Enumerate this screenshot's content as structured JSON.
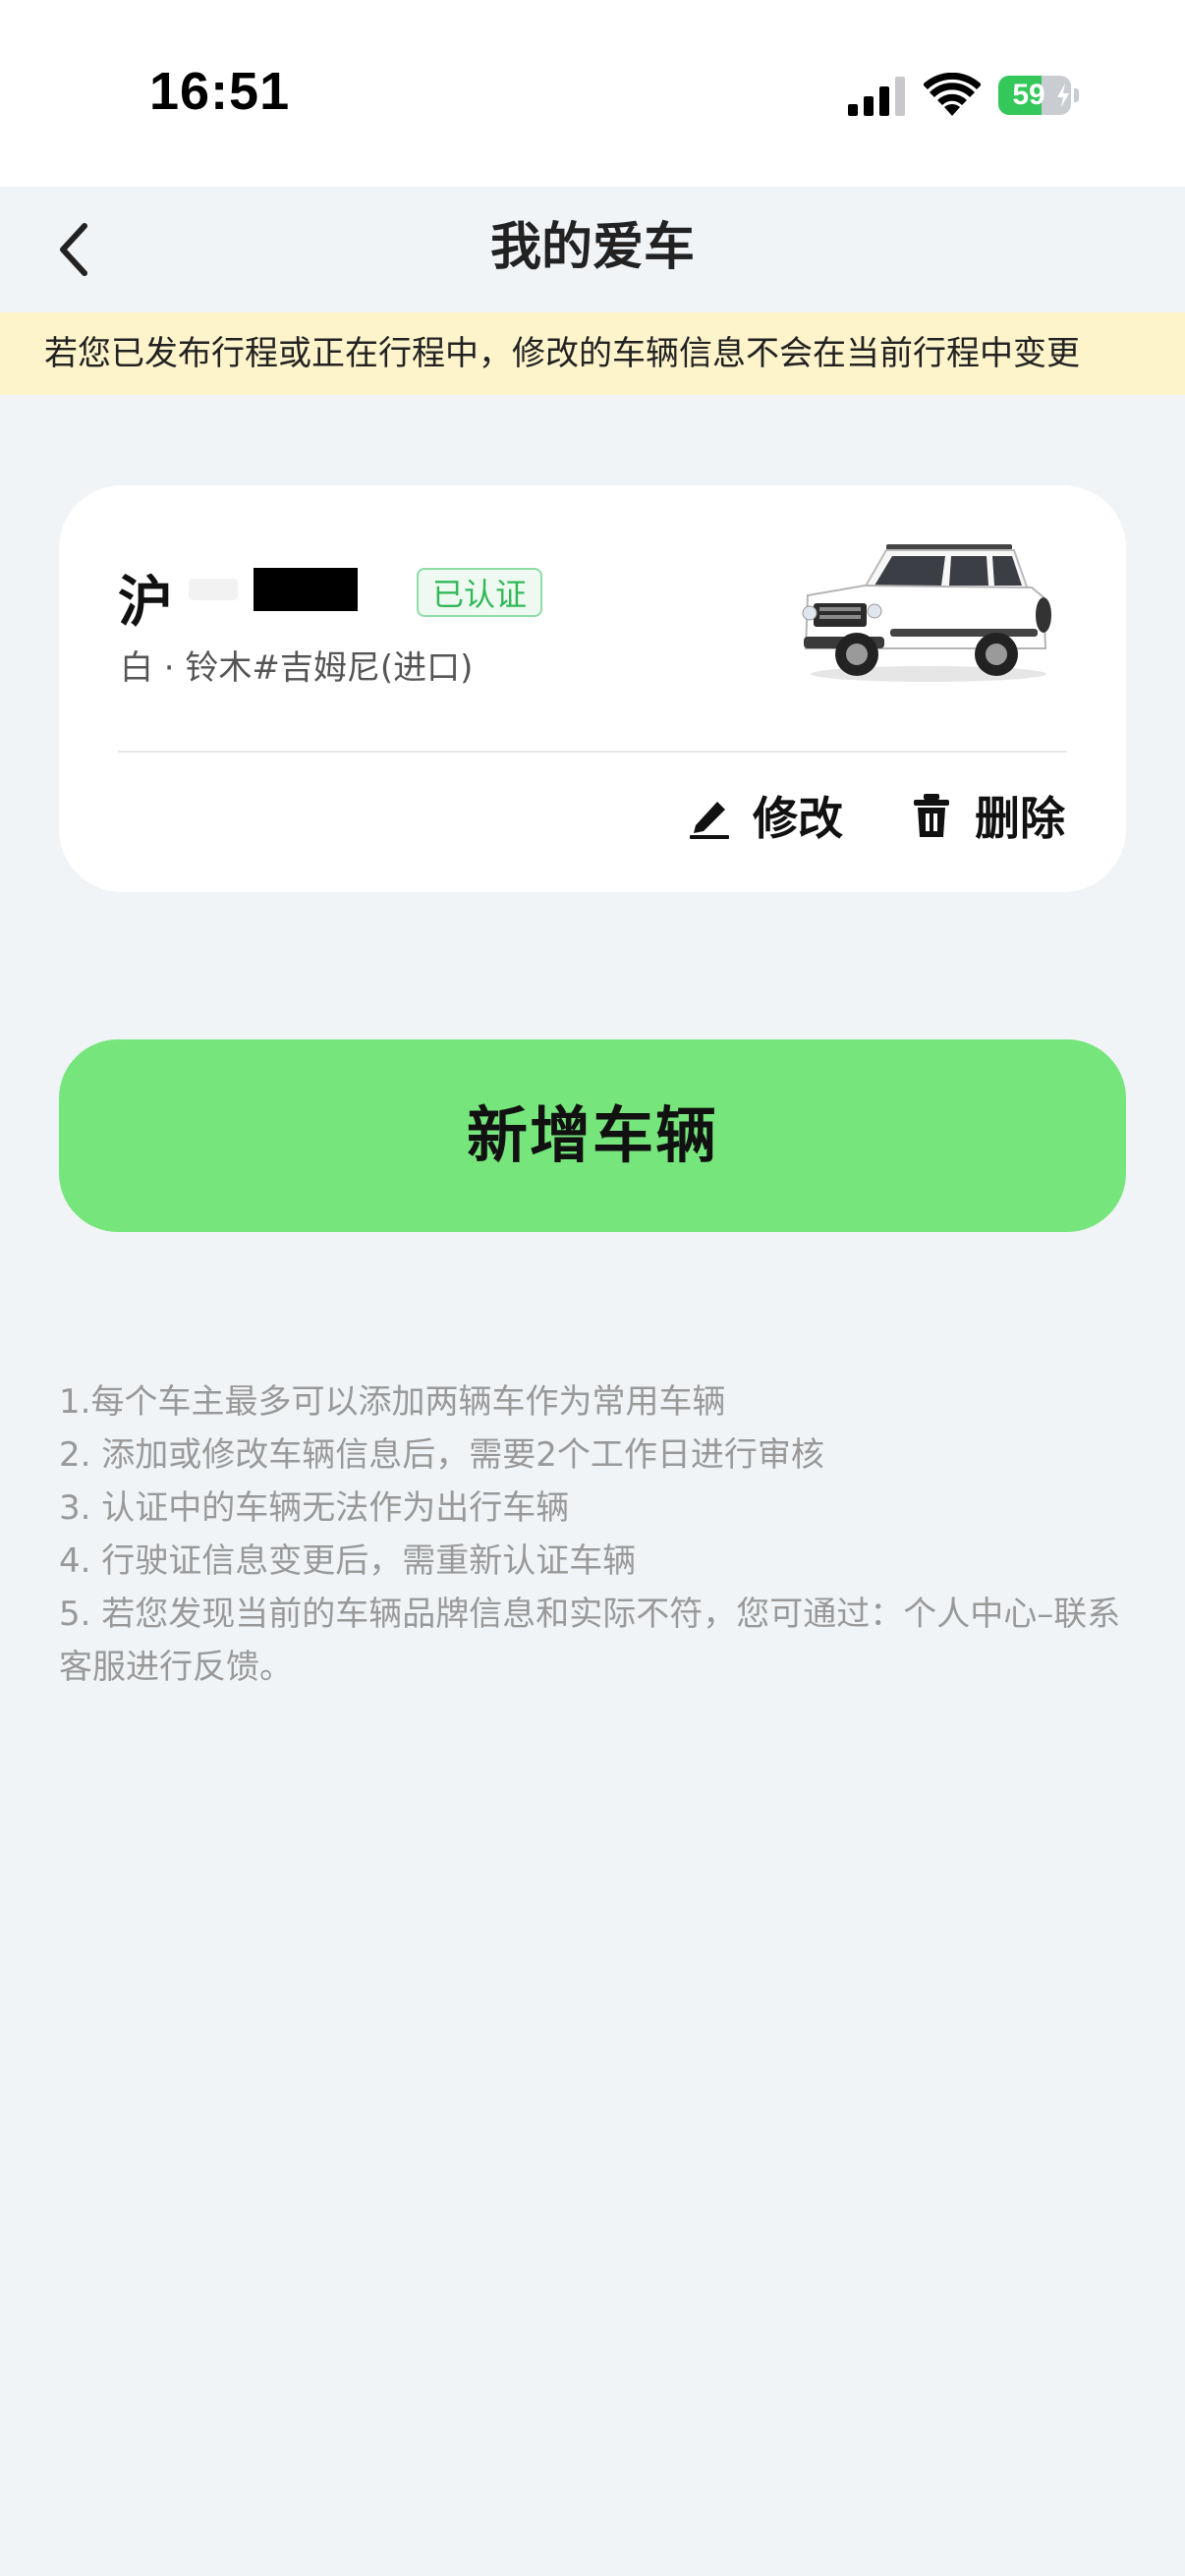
{
  "status_bar": {
    "time": "16:51",
    "battery_percent": "59",
    "battery_level": 0.59,
    "icons": [
      "signal-icon",
      "wifi-icon",
      "battery-icon",
      "charging-bolt-icon"
    ]
  },
  "header": {
    "title": "我的爱车",
    "back_icon": "chevron-left-icon"
  },
  "notice": {
    "text": "若您已发布行程或正在行程中，修改的车辆信息不会在当前行程中变更"
  },
  "vehicle": {
    "plate_prefix": "沪",
    "status_badge": "已认证",
    "description": "白 · 铃木#吉姆尼(进口)",
    "image": "white-suv-image",
    "edit_label": "修改",
    "edit_icon": "pencil-icon",
    "delete_label": "删除",
    "delete_icon": "trash-icon"
  },
  "actions": {
    "add_vehicle_label": "新增车辆"
  },
  "tips": [
    "1.每个车主最多可以添加两辆车作为常用车辆",
    "2. 添加或修改车辆信息后，需要2个工作日进行审核",
    "3. 认证中的车辆无法作为出行车辆",
    "4. 行驶证信息变更后，需重新认证车辆",
    "5. 若您发现当前的车辆品牌信息和实际不符，您可通过：个人中心–联系客服进行反馈。"
  ],
  "colors": {
    "page_background": "#f0f4f7",
    "notice_background": "#fdf4cc",
    "accent_green": "#76e57b",
    "badge_green": "#33b859",
    "tip_text": "#999999"
  }
}
